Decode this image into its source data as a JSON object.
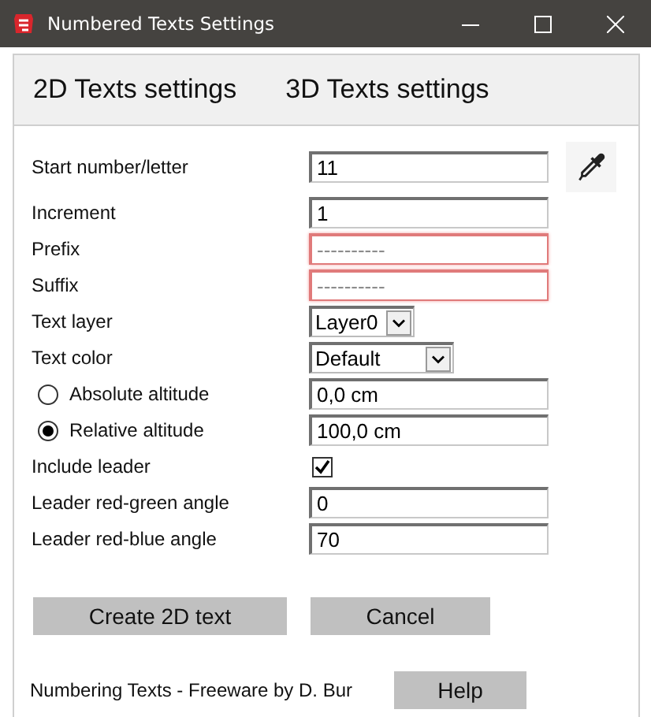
{
  "window": {
    "title": "Numbered Texts Settings"
  },
  "tabs": [
    {
      "label": "2D Texts settings"
    },
    {
      "label": "3D Texts settings"
    }
  ],
  "rows": [
    {
      "kind": "picker",
      "label": "Start number/letter",
      "value": "11"
    },
    {
      "kind": "text",
      "label": "Increment",
      "value": "1"
    },
    {
      "kind": "text",
      "label": "Prefix",
      "placeholder": "----------",
      "invalid": true
    },
    {
      "kind": "text",
      "label": "Suffix",
      "placeholder": "----------",
      "invalid": true
    },
    {
      "kind": "select",
      "label": "Text layer",
      "value": "Layer0"
    },
    {
      "kind": "select",
      "label": "Text color",
      "value": "Default",
      "wide": true
    },
    {
      "kind": "radio",
      "label": "Absolute altitude",
      "value": "0,0 cm",
      "selected": false
    },
    {
      "kind": "radio",
      "label": "Relative altitude",
      "value": "100,0 cm",
      "selected": true
    },
    {
      "kind": "checkbox",
      "label": "Include leader",
      "checked": true
    },
    {
      "kind": "text",
      "label": "Leader red-green angle",
      "value": "0"
    },
    {
      "kind": "text",
      "label": "Leader red-blue angle",
      "value": "70"
    }
  ],
  "buttons": [
    "Create 2D text",
    "Cancel"
  ],
  "footer": {
    "text": "Numbering Texts - Freeware by D. Bur",
    "button": "Help"
  }
}
